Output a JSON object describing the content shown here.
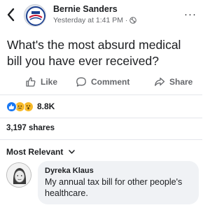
{
  "post": {
    "author": "Bernie Sanders",
    "timestamp": "Yesterday at 1:41 PM · ",
    "privacy_icon": "globe-icon",
    "text": "What's the most absurd medical bill you have ever received?"
  },
  "header": {
    "back_icon": "chevron-left-icon",
    "more_label": "···"
  },
  "actions": {
    "like": "Like",
    "comment": "Comment",
    "share": "Share"
  },
  "reactions": {
    "count": "8.8K",
    "types": [
      "like",
      "sad",
      "wow"
    ]
  },
  "shares": "3,197 shares",
  "comments": {
    "sort_label": "Most Relevant",
    "items": [
      {
        "author": "Dyreka Klaus",
        "text": "My annual tax bill for other people's healthcare."
      }
    ]
  },
  "colors": {
    "text": "#1c1e21",
    "muted": "#65676b",
    "like_blue": "#1877f2",
    "reaction_yellow": "#f7b928",
    "bubble": "#f0f2f5"
  }
}
